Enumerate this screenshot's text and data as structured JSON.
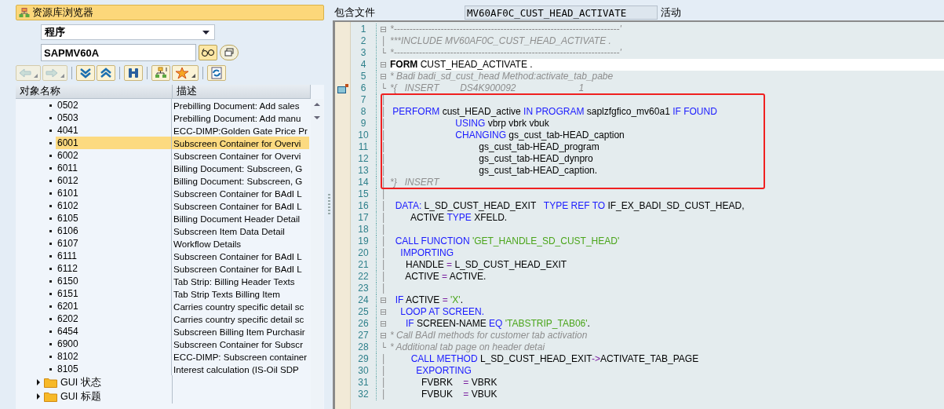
{
  "browser": {
    "title": "资源库浏览器",
    "object_type": "程序",
    "object_name": "SAPMV60A",
    "toolbar": [
      {
        "kind": "back",
        "disabled": true,
        "dropdown": true
      },
      {
        "kind": "forward",
        "disabled": true,
        "dropdown": true
      },
      {
        "kind": "expand",
        "disabled": false,
        "dropdown": false
      },
      {
        "kind": "collapse",
        "disabled": false,
        "dropdown": false
      },
      {
        "kind": "find",
        "disabled": false,
        "dropdown": false
      },
      {
        "kind": "hierarchy",
        "disabled": false,
        "dropdown": false
      },
      {
        "kind": "favorites",
        "disabled": false,
        "dropdown": true
      },
      {
        "kind": "refresh",
        "disabled": false,
        "dropdown": false
      }
    ],
    "columns": [
      "对象名称",
      "描述"
    ],
    "rows": [
      {
        "name": "0502",
        "desc": "Prebilling Document: Add sales",
        "selected": false
      },
      {
        "name": "0503",
        "desc": "Prebilling Document: Add manu",
        "selected": false
      },
      {
        "name": "4041",
        "desc": "ECC-DIMP:Golden Gate Price Pr",
        "selected": false
      },
      {
        "name": "6001",
        "desc": "Subscreen Container for Overvi",
        "selected": true
      },
      {
        "name": "6002",
        "desc": "Subscreen Container for Overvi",
        "selected": false
      },
      {
        "name": "6011",
        "desc": "Billing Document: Subscreen, G",
        "selected": false
      },
      {
        "name": "6012",
        "desc": "Billing Document: Subscreen, G",
        "selected": false
      },
      {
        "name": "6101",
        "desc": "Subscreen Container for BAdI L",
        "selected": false
      },
      {
        "name": "6102",
        "desc": "Subscreen Container for BAdI L",
        "selected": false
      },
      {
        "name": "6105",
        "desc": "Billing Document Header Detail",
        "selected": false
      },
      {
        "name": "6106",
        "desc": "Subscreen Item Data Detail",
        "selected": false
      },
      {
        "name": "6107",
        "desc": "Workflow Details",
        "selected": false
      },
      {
        "name": "6111",
        "desc": "Subscreen Container for BAdI L",
        "selected": false
      },
      {
        "name": "6112",
        "desc": "Subscreen Container for BAdI L",
        "selected": false
      },
      {
        "name": "6150",
        "desc": "Tab Strip: Billing Header Texts",
        "selected": false
      },
      {
        "name": "6151",
        "desc": "Tab Strip Texts Billing Item",
        "selected": false
      },
      {
        "name": "6201",
        "desc": "Carries country specific detail sc",
        "selected": false
      },
      {
        "name": "6202",
        "desc": "Carries country specific detail sc",
        "selected": false
      },
      {
        "name": "6454",
        "desc": "Subscreen Billing Item Purchasir",
        "selected": false
      },
      {
        "name": "6900",
        "desc": "Subscreen Container for Subscr",
        "selected": false
      },
      {
        "name": "8102",
        "desc": "ECC-DIMP: Subscreen container",
        "selected": false
      },
      {
        "name": "8105",
        "desc": "Interest calculation (IS-Oil SDP",
        "selected": false
      }
    ],
    "folders": [
      {
        "label": "GUI 状态",
        "expanded": false
      },
      {
        "label": "GUI 标题",
        "expanded": false
      }
    ]
  },
  "editor": {
    "include_label": "包含文件",
    "include_name": "MV60AF0C_CUST_HEAD_ACTIVATE",
    "status": "活动",
    "blocks": [
      {
        "boxed": false,
        "lines": [
          {
            "n": "1",
            "fold": "⊟",
            "current": false,
            "marker": false,
            "tokens": [
              {
                "kind": "cmt",
                "t": "*------------------------------------------------------------------------'"
              }
            ]
          },
          {
            "n": "2",
            "fold": "│",
            "current": false,
            "marker": false,
            "tokens": [
              {
                "kind": "cmt",
                "t": "***INCLUDE MV60AF0C_CUST_HEAD_ACTIVATE ."
              }
            ]
          },
          {
            "n": "3",
            "fold": "└",
            "current": false,
            "marker": false,
            "tokens": [
              {
                "kind": "cmt",
                "t": "*------------------------------------------------------------------------'"
              }
            ]
          },
          {
            "n": "4",
            "fold": "⊟",
            "current": true,
            "marker": false,
            "tokens": [
              {
                "kind": "bold",
                "t": "FORM"
              },
              {
                "kind": "plain",
                "t": " CUST_HEAD_ACTIVATE ."
              }
            ]
          },
          {
            "n": "5",
            "fold": "⊟",
            "current": false,
            "marker": false,
            "tokens": [
              {
                "kind": "cmt",
                "t": "* Badi badi_sd_cust_head Method:activate_tab_pabe"
              }
            ]
          },
          {
            "n": "6",
            "fold": "└",
            "current": false,
            "marker": true,
            "tokens": [
              {
                "kind": "cmt",
                "t": "*{   INSERT        DS4K900092                        1"
              }
            ]
          }
        ]
      },
      {
        "boxed": true,
        "lines": [
          {
            "n": "7",
            "fold": "│",
            "current": false,
            "marker": false
          },
          {
            "n": "8",
            "fold": "│",
            "current": false,
            "marker": false,
            "tokens": [
              {
                "kind": "kw",
                "t": " PERFORM"
              },
              {
                "kind": "plain",
                "t": " cust_HEAD_active "
              },
              {
                "kind": "kw",
                "t": "IN PROGRAM"
              },
              {
                "kind": "plain",
                "t": " saplzfgfico_mv60a1 "
              },
              {
                "kind": "kw",
                "t": "IF FOUND"
              }
            ]
          },
          {
            "n": "9",
            "fold": "│",
            "current": false,
            "marker": false,
            "tokens": [
              {
                "kind": "kw",
                "t": "                         USING"
              },
              {
                "kind": "plain",
                "t": " vbrp vbrk vbuk"
              }
            ]
          },
          {
            "n": "10",
            "fold": "│",
            "current": false,
            "marker": false,
            "tokens": [
              {
                "kind": "kw",
                "t": "                         CHANGING"
              },
              {
                "kind": "plain",
                "t": " gs_cust_tab-HEAD_caption"
              }
            ]
          },
          {
            "n": "11",
            "fold": "│",
            "current": false,
            "marker": false,
            "tokens": [
              {
                "kind": "plain",
                "t": "                                  gs_cust_tab-HEAD_program"
              }
            ]
          },
          {
            "n": "12",
            "fold": "│",
            "current": false,
            "marker": false,
            "tokens": [
              {
                "kind": "plain",
                "t": "                                  gs_cust_tab-HEAD_dynpro"
              }
            ]
          },
          {
            "n": "13",
            "fold": "│",
            "current": false,
            "marker": false,
            "tokens": [
              {
                "kind": "plain",
                "t": "                                  gs_cust_tab-HEAD_caption."
              }
            ]
          },
          {
            "n": "14",
            "fold": "│",
            "current": false,
            "marker": false,
            "tokens": [
              {
                "kind": "cmt",
                "t": "*}   INSERT"
              }
            ]
          }
        ]
      },
      {
        "boxed": false,
        "lines": [
          {
            "n": "15",
            "fold": "│",
            "current": false,
            "marker": false
          },
          {
            "n": "16",
            "fold": "│",
            "current": false,
            "marker": false,
            "tokens": [
              {
                "kind": "kw",
                "t": "  DATA:"
              },
              {
                "kind": "plain",
                "t": " L_SD_CUST_HEAD_EXIT   "
              },
              {
                "kind": "kw",
                "t": "TYPE REF TO"
              },
              {
                "kind": "plain",
                "t": " IF_EX_BADI_SD_CUST_HEAD,"
              }
            ]
          },
          {
            "n": "17",
            "fold": "│",
            "current": false,
            "marker": false,
            "tokens": [
              {
                "kind": "plain",
                "t": "        ACTIVE "
              },
              {
                "kind": "kw",
                "t": "TYPE"
              },
              {
                "kind": "plain",
                "t": " XFELD."
              }
            ]
          },
          {
            "n": "18",
            "fold": "│",
            "current": false,
            "marker": false
          },
          {
            "n": "19",
            "fold": "│",
            "current": false,
            "marker": false,
            "tokens": [
              {
                "kind": "kw",
                "t": "  CALL FUNCTION"
              },
              {
                "kind": "str",
                "t": " 'GET_HANDLE_SD_CUST_HEAD'"
              }
            ]
          },
          {
            "n": "20",
            "fold": "│",
            "current": false,
            "marker": false,
            "tokens": [
              {
                "kind": "kw",
                "t": "    IMPORTING"
              }
            ]
          },
          {
            "n": "21",
            "fold": "│",
            "current": false,
            "marker": false,
            "tokens": [
              {
                "kind": "plain",
                "t": "      HANDLE "
              },
              {
                "kind": "op",
                "t": "="
              },
              {
                "kind": "plain",
                "t": " L_SD_CUST_HEAD_EXIT"
              }
            ]
          },
          {
            "n": "22",
            "fold": "│",
            "current": false,
            "marker": false,
            "tokens": [
              {
                "kind": "plain",
                "t": "      ACTIVE "
              },
              {
                "kind": "op",
                "t": "="
              },
              {
                "kind": "plain",
                "t": " ACTIVE."
              }
            ]
          },
          {
            "n": "23",
            "fold": "│",
            "current": false,
            "marker": false
          },
          {
            "n": "24",
            "fold": "⊟",
            "current": false,
            "marker": false,
            "tokens": [
              {
                "kind": "kw",
                "t": "  IF"
              },
              {
                "kind": "plain",
                "t": " ACTIVE "
              },
              {
                "kind": "op",
                "t": "="
              },
              {
                "kind": "str",
                "t": " 'X'"
              },
              {
                "kind": "plain",
                "t": "."
              }
            ]
          },
          {
            "n": "25",
            "fold": "⊟",
            "current": false,
            "marker": false,
            "tokens": [
              {
                "kind": "kw",
                "t": "    LOOP AT SCREEN."
              }
            ]
          },
          {
            "n": "26",
            "fold": "⊟",
            "current": false,
            "marker": false,
            "tokens": [
              {
                "kind": "kw",
                "t": "      IF"
              },
              {
                "kind": "plain",
                "t": " SCREEN-NAME "
              },
              {
                "kind": "kw",
                "t": "EQ"
              },
              {
                "kind": "str",
                "t": " 'TABSTRIP_TAB06'"
              },
              {
                "kind": "plain",
                "t": "."
              }
            ]
          },
          {
            "n": "27",
            "fold": "⊟",
            "current": false,
            "marker": false,
            "tokens": [
              {
                "kind": "cmt",
                "t": "* Call BAdI methods for customer tab activation"
              }
            ]
          },
          {
            "n": "28",
            "fold": "└",
            "current": false,
            "marker": false,
            "tokens": [
              {
                "kind": "cmt",
                "t": "* Additional tab page on header detai"
              }
            ]
          },
          {
            "n": "29",
            "fold": "│",
            "current": false,
            "marker": false,
            "tokens": [
              {
                "kind": "kw",
                "t": "        CALL METHOD"
              },
              {
                "kind": "plain",
                "t": " L_SD_CUST_HEAD_EXIT"
              },
              {
                "kind": "op",
                "t": "->"
              },
              {
                "kind": "plain",
                "t": "ACTIVATE_TAB_PAGE"
              }
            ]
          },
          {
            "n": "30",
            "fold": "│",
            "current": false,
            "marker": false,
            "tokens": [
              {
                "kind": "kw",
                "t": "          EXPORTING"
              }
            ]
          },
          {
            "n": "31",
            "fold": "│",
            "current": false,
            "marker": false,
            "tokens": [
              {
                "kind": "plain",
                "t": "            FVBRK    "
              },
              {
                "kind": "op",
                "t": "="
              },
              {
                "kind": "plain",
                "t": " VBRK"
              }
            ]
          },
          {
            "n": "32",
            "fold": "│",
            "current": false,
            "marker": false,
            "tokens": [
              {
                "kind": "plain",
                "t": "            FVBUK    "
              },
              {
                "kind": "op",
                "t": "="
              },
              {
                "kind": "plain",
                "t": " VBUK"
              }
            ]
          }
        ]
      }
    ]
  }
}
